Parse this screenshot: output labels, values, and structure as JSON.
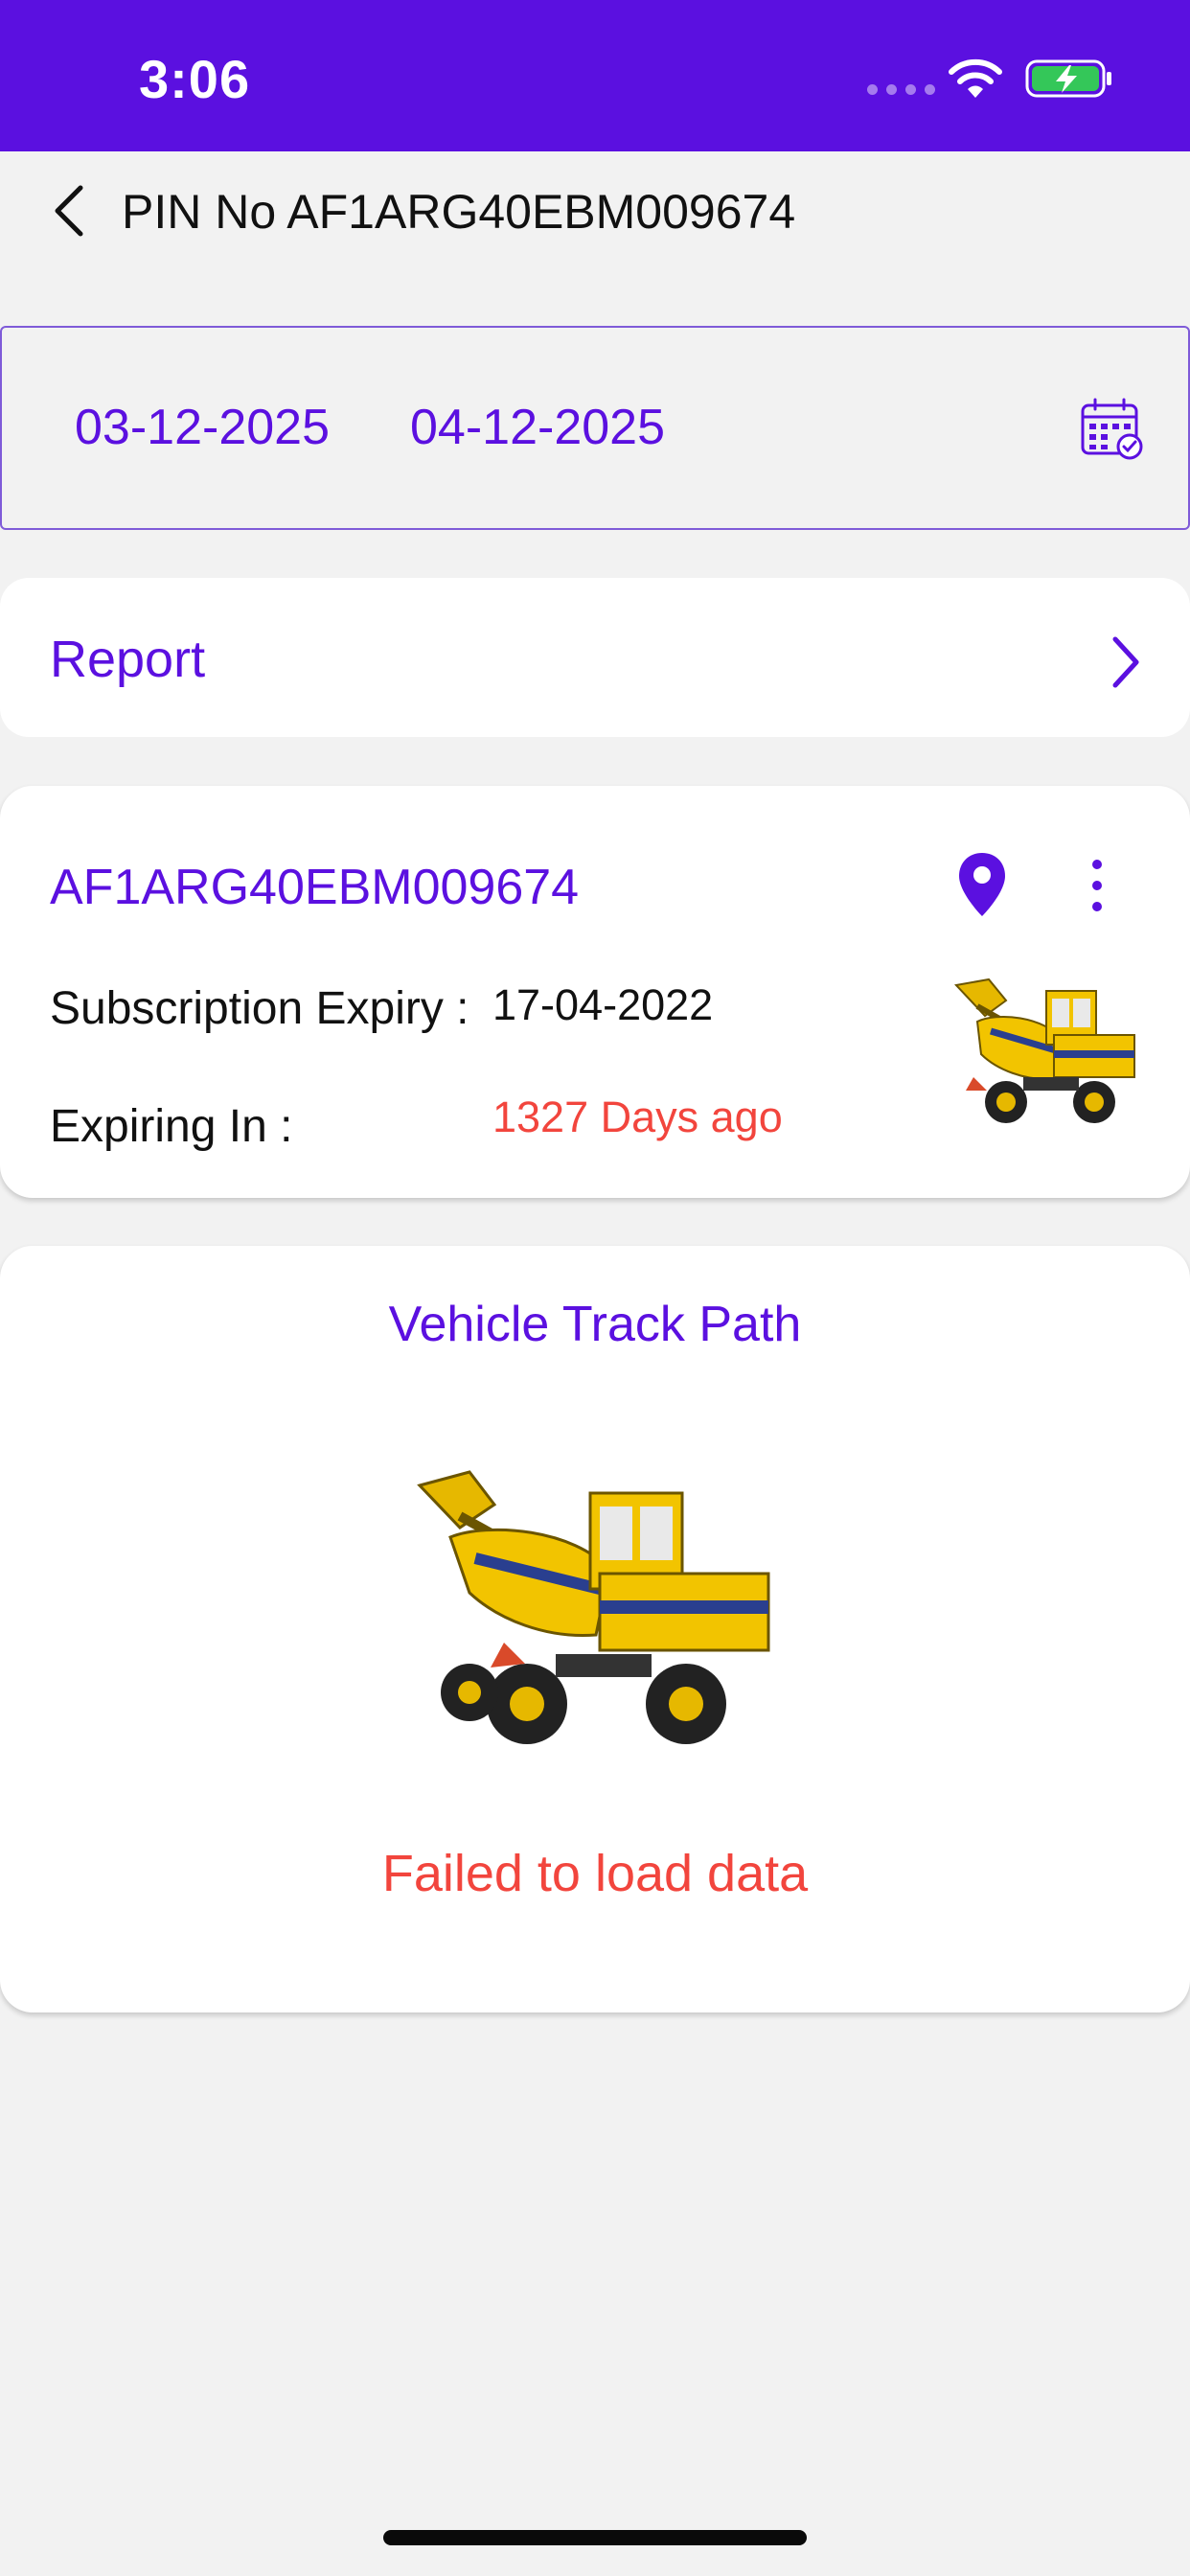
{
  "status_bar": {
    "time": "3:06",
    "background_color": "#5b10e0",
    "icons": [
      "signal-icon",
      "wifi-icon",
      "battery-charging-icon"
    ]
  },
  "header": {
    "back_icon": "chevron-left-icon",
    "title": "PIN No AF1ARG40EBM009674"
  },
  "date_range": {
    "start_date": "03-12-2025",
    "end_date": "04-12-2025",
    "icon": "calendar-icon"
  },
  "report": {
    "label": "Report",
    "icon": "chevron-right-icon"
  },
  "vehicle": {
    "pin": "AF1ARG40EBM009674",
    "subscription_label": "Subscription Expiry :",
    "subscription_value": "17-04-2022",
    "expiring_label": "Expiring In :",
    "expiring_value": "1327 Days ago",
    "icons": [
      "location-pin-icon",
      "more-vertical-icon"
    ],
    "image": "self-loading-concrete-mixer"
  },
  "track": {
    "title": "Vehicle Track Path",
    "error": "Failed to load data",
    "image": "self-loading-concrete-mixer"
  },
  "colors": {
    "accent": "#5b10e0",
    "error": "#f2453d",
    "background": "#f2f2f2"
  }
}
